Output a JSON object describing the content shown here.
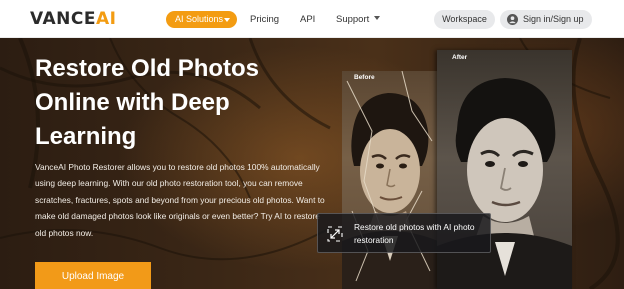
{
  "header": {
    "logo_main": "VANCE",
    "logo_accent": "AI",
    "nav": {
      "ai_solutions": "AI Solutions",
      "pricing": "Pricing",
      "api": "API",
      "support": "Support"
    },
    "workspace": "Workspace",
    "signin": "Sign in/Sign up"
  },
  "hero": {
    "headline": "Restore Old Photos Online with Deep Learning",
    "description": "VanceAI Photo Restorer allows you to restore old photos 100% automatically using deep learning. With our old photo restoration tool, you can remove scratches, fractures, spots and beyond from your precious old photos. Want to make old damaged photos look like originals or even better? Try AI to restore old photos now.",
    "upload_button": "Upload Image",
    "before_label": "Before",
    "after_label": "After",
    "tooltip": "Restore old photos with AI photo restoration"
  },
  "colors": {
    "accent": "#f39c12",
    "hero_bg": "#3b2716"
  },
  "icons": {
    "user": "user-icon",
    "caret": "chevron-down-icon",
    "expand": "expand-icon"
  }
}
